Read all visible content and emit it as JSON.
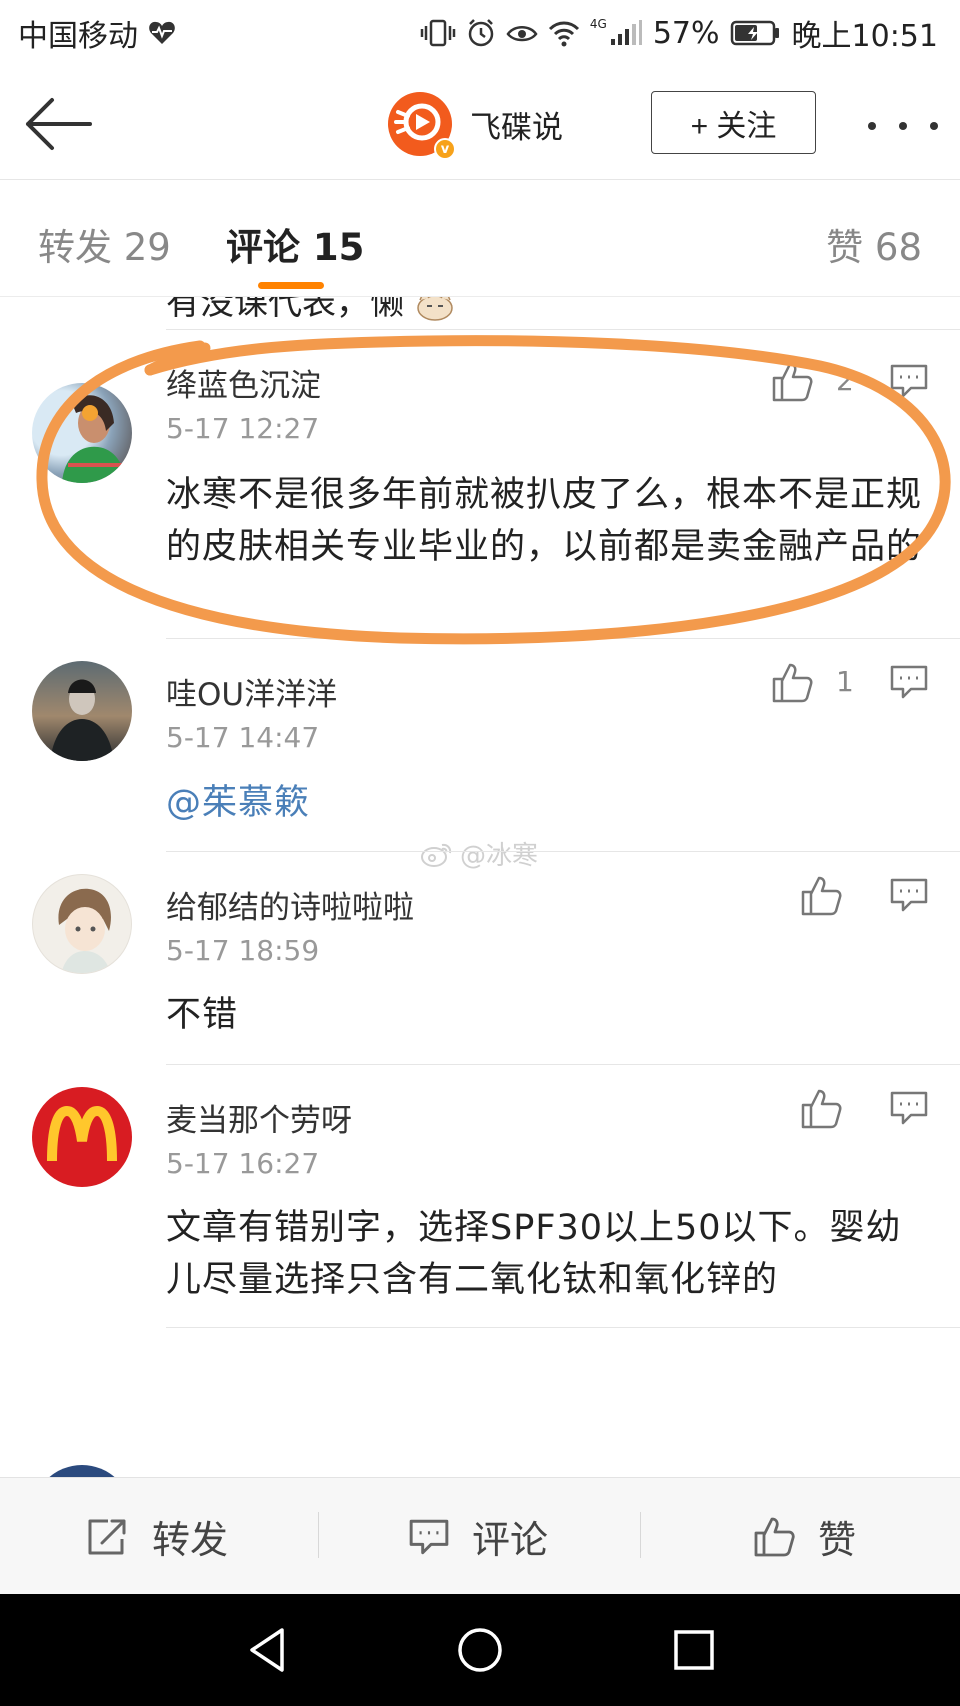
{
  "status_bar": {
    "carrier": "中国移动",
    "network": "4G",
    "battery": "57%",
    "time": "晚上10:51"
  },
  "header": {
    "account_name": "飞碟说",
    "follow_label": "+ 关注"
  },
  "tabs": {
    "repost": "转发 29",
    "comments": "评论 15",
    "likes": "赞 68"
  },
  "partial_text": "有没课代表，懒",
  "comments": [
    {
      "username": "绛蓝色沉淀",
      "time": "5-17 12:27",
      "text": "冰寒不是很多年前就被扒皮了么，根本不是正规的皮肤相关专业毕业的，以前都是卖金融产品的",
      "likes": "2"
    },
    {
      "username": "哇OU洋洋洋",
      "time": "5-17 14:47",
      "text": "@茱慕簌",
      "likes": "1"
    },
    {
      "username": "给郁结的诗啦啦啦",
      "time": "5-17 18:59",
      "text": "不错",
      "likes": ""
    },
    {
      "username": "麦当那个劳呀",
      "time": "5-17 16:27",
      "text": "文章有错别字，选择SPF30以上50以下。婴幼儿尽量选择只含有二氧化钛和氧化锌的",
      "likes": ""
    }
  ],
  "watermark": "@冰寒",
  "action_bar": {
    "repost": "转发",
    "comment": "评论",
    "like": "赞"
  },
  "colors": {
    "accent": "#ff8200",
    "annotation": "#f39a4c",
    "mention": "#4a7fb8"
  }
}
